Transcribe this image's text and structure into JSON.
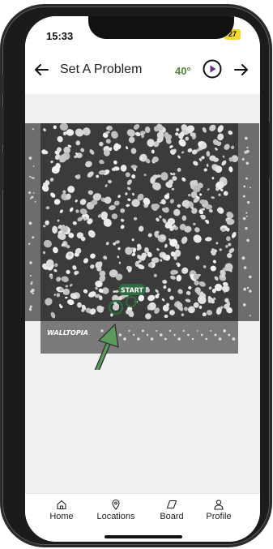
{
  "status_bar": {
    "time": "15:33",
    "network": "5G",
    "battery": "27"
  },
  "header": {
    "title": "Set A Problem",
    "angle": "40°"
  },
  "board": {
    "brand": "WALLTOPIA",
    "start_label": "START"
  },
  "bottom_nav": {
    "items": [
      {
        "label": "Home",
        "icon": "home-icon"
      },
      {
        "label": "Locations",
        "icon": "location-pin-icon"
      },
      {
        "label": "Board",
        "icon": "board-icon"
      },
      {
        "label": "Profile",
        "icon": "profile-icon"
      }
    ]
  },
  "colors": {
    "accent_green": "#4b8a3a",
    "start_badge": "#2e6b3e",
    "arrow_green": "#5c9a5c",
    "battery": "#f3da2a"
  }
}
